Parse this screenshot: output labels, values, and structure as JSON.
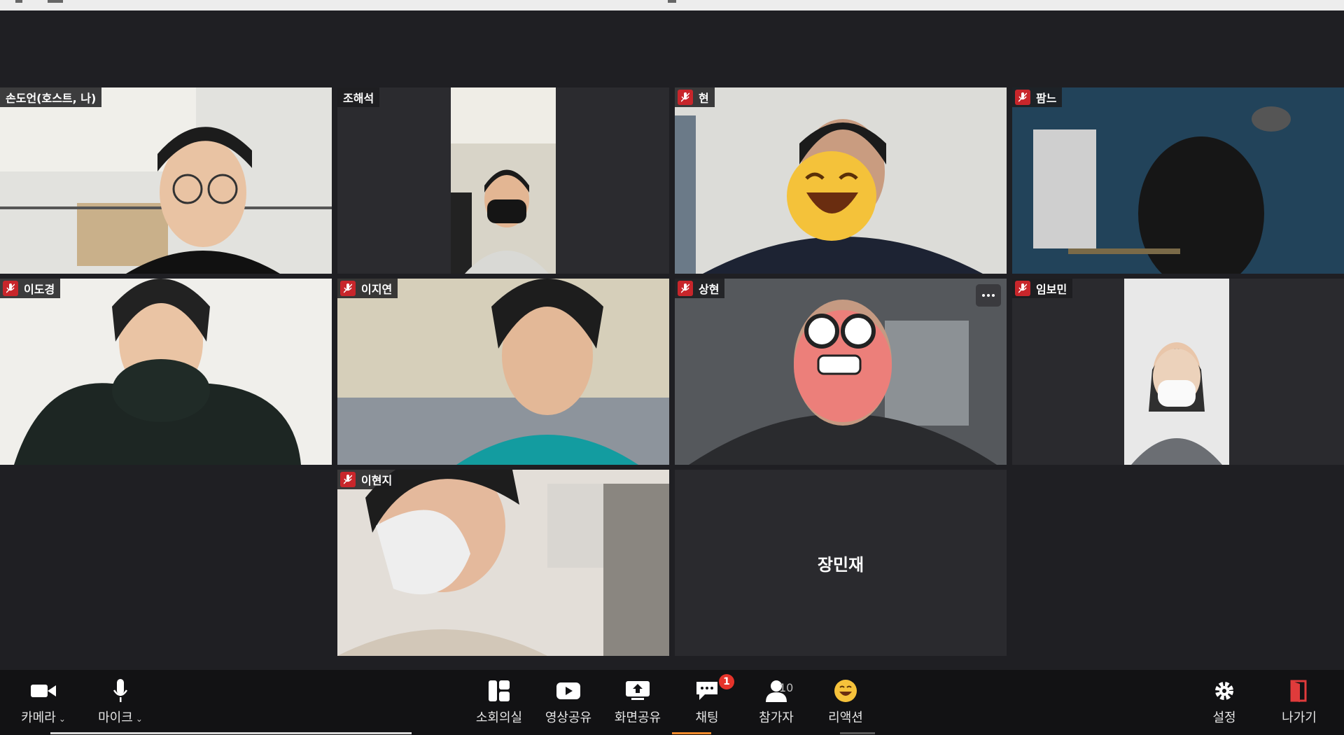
{
  "participants": [
    {
      "name": "손도언(호스트, 나)",
      "muted": false
    },
    {
      "name": "조해석",
      "muted": false
    },
    {
      "name": "현",
      "muted": true
    },
    {
      "name": "팜느",
      "muted": true
    },
    {
      "name": "이도경",
      "muted": true
    },
    {
      "name": "이지연",
      "muted": true
    },
    {
      "name": "상현",
      "muted": true
    },
    {
      "name": "임보민",
      "muted": true
    },
    {
      "name": "이현지",
      "muted": true
    },
    {
      "name": "장민재",
      "muted": false
    }
  ],
  "toolbar": {
    "camera": "카메라",
    "mic": "마이크",
    "breakout": "소회의실",
    "video_share": "영상공유",
    "screen_share": "화면공유",
    "chat": "채팅",
    "chat_badge": "1",
    "participants": "참가자",
    "participants_count": "10",
    "reaction": "리액션",
    "settings": "설정",
    "leave": "나가기"
  },
  "colors": {
    "mute_red": "#c8262b",
    "leave_red": "#e03b3b",
    "chat_badge": "#e5332a"
  }
}
